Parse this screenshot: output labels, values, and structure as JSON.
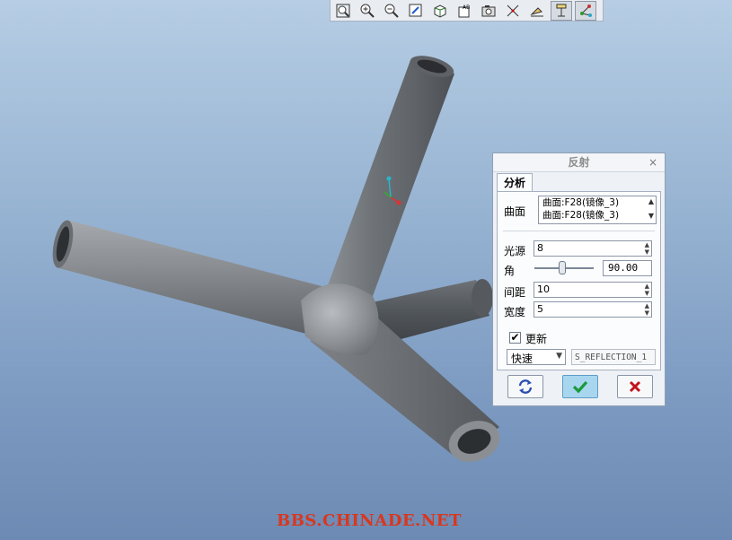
{
  "toolbar": {
    "icons": [
      "zoom-fit-icon",
      "zoom-in-icon",
      "zoom-out-icon",
      "repaint-icon",
      "orient-icon",
      "view-manager-icon",
      "saved-views-icon",
      "datum-display-icon",
      "spin-center-icon",
      "annotation-icon",
      "csys-display-icon"
    ]
  },
  "dialog": {
    "title": "反射",
    "close": "×",
    "tab": "分析",
    "surface_label": "曲面",
    "surfaces": [
      "曲面:F28(镜像_3)",
      "曲面:F28(镜像_3)"
    ],
    "light_source_label": "光源",
    "light_source_value": "8",
    "angle_label": "角",
    "angle_value": "90.00",
    "angle_slider": 0.5,
    "spacing_label": "间距",
    "spacing_value": "10",
    "width_label": "宽度",
    "width_value": "5",
    "update_label": "更新",
    "update_checked": true,
    "quality_value": "快速",
    "name_value": "S_REFLECTION_1"
  },
  "watermark": "BBS.CHINADE.NET",
  "colors": {
    "ok": "#1a9a3a",
    "cancel": "#c0141b",
    "refresh": "#2b4fb0",
    "watermark": "#d9371f"
  }
}
